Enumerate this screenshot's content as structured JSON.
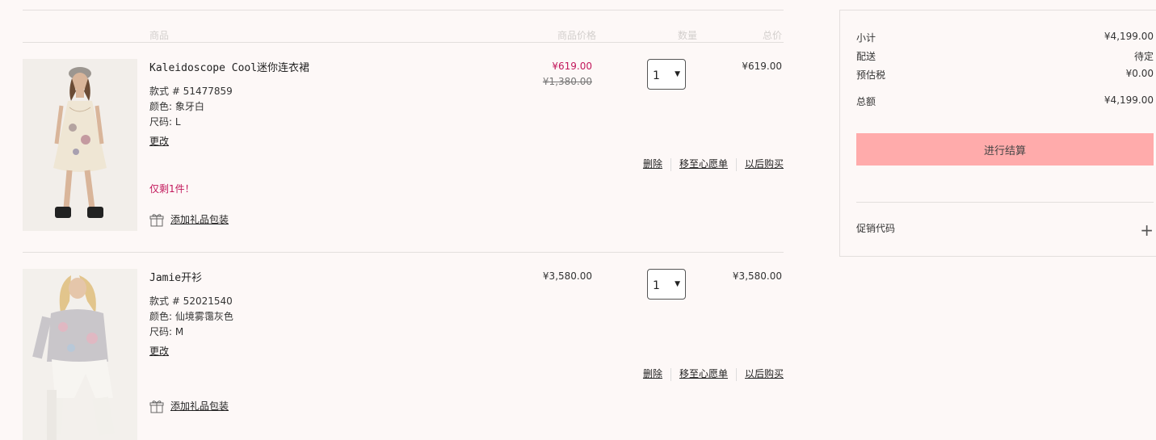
{
  "table_headers": {
    "product": "商品",
    "price": "商品价格",
    "qty": "数量",
    "total": "总价"
  },
  "items": [
    {
      "name": "Kaleidoscope Cool迷你连衣裙",
      "style": "款式 # 51477859",
      "color": "颜色: 象牙白",
      "size": "尺码: L",
      "edit": "更改",
      "sale_price": "¥619.00",
      "orig_price": "¥1,380.00",
      "qty": "1",
      "total": "¥619.00",
      "delete": "删除",
      "wishlist": "移至心愿单",
      "later": "以后购买",
      "low_stock": "仅剩1件！",
      "gift": "添加礼品包装"
    },
    {
      "name": "Jamie开衫",
      "style": "款式 # 52021540",
      "color": "颜色: 仙境雾霭灰色",
      "size": "尺码: M",
      "edit": "更改",
      "price": "¥3,580.00",
      "qty": "1",
      "total": "¥3,580.00",
      "delete": "删除",
      "wishlist": "移至心愿单",
      "later": "以后购买",
      "gift": "添加礼品包装"
    }
  ],
  "summary": {
    "subtotal_label": "小计",
    "subtotal": "¥4,199.00",
    "shipping_label": "配送",
    "shipping": "待定",
    "tax_label": "预估税",
    "tax": "¥0.00",
    "total_label": "总额",
    "total": "¥4,199.00",
    "checkout": "进行结算",
    "promo_label": "促销代码"
  },
  "colors": {
    "sale": "#c2185b",
    "checkout_bg": "#ffabab",
    "page_bg": "#fdf8f7"
  },
  "icons": {
    "gift": "gift-icon",
    "caret": "caret-down-icon",
    "plus": "plus-icon"
  }
}
